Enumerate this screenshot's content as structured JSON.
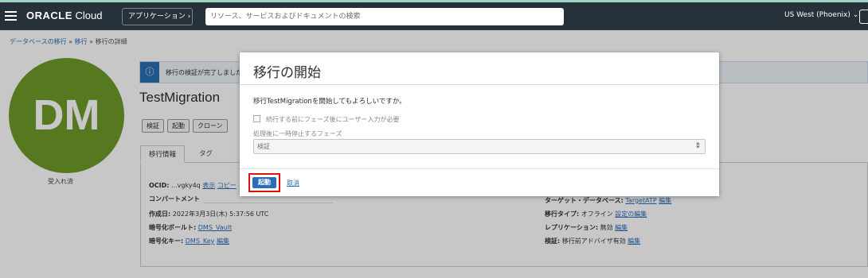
{
  "topbar": {
    "brand": "ORACLE",
    "brand_suffix": "Cloud",
    "apps_label": "アプリケーション",
    "search_placeholder": "リソース、サービスおよびドキュメントの検索",
    "region": "US West (Phoenix)"
  },
  "breadcrumb": {
    "items": [
      "データベースの移行",
      "移行",
      "移行の詳細"
    ],
    "separator": "»"
  },
  "avatar": {
    "initials": "DM",
    "status": "受入れ済",
    "color": "#6f9a28"
  },
  "banner": {
    "text": "移行の検証が完了しました"
  },
  "page_title": "TestMigration",
  "actions": [
    "検証",
    "起動",
    "クローン"
  ],
  "tabs": [
    "移行情報",
    "タグ"
  ],
  "details": {
    "ocid_label": "OCID:",
    "ocid_value": "...vgky4q",
    "show_link": "表示",
    "copy_link": "コピー",
    "compartment_label": "コンパートメント",
    "created_label": "作成日:",
    "created_value": "2022年3月3日(木) 5:37:56 UTC",
    "vault_label": "暗号化ボールト:",
    "vault_value": "DMS_Vault",
    "key_label": "暗号化キー:",
    "key_value": "DMS_Key",
    "edit_link": "編集",
    "target_label": "ターゲット・データベース:",
    "target_value": "TargetATP",
    "type_label": "移行タイプ:",
    "type_value": "オフライン",
    "settings_edit": "設定の編集",
    "replication_label": "レプリケーション:",
    "replication_value": "無効",
    "validation_label": "検証:",
    "validation_value": "移行前アドバイザ有効"
  },
  "dialog": {
    "title": "移行の開始",
    "question": "移行TestMigrationを開始してもよろしいですか。",
    "checkbox_label": "続行する前にフェーズ後にユーザー入力が必要",
    "phase_label": "処理後に一時停止するフェーズ",
    "phase_value": "検証",
    "start_label": "起動",
    "cancel_label": "取消"
  },
  "colors": {
    "topbar": "#27313a",
    "accent": "#2a6ebb",
    "highlight": "#e01010"
  }
}
